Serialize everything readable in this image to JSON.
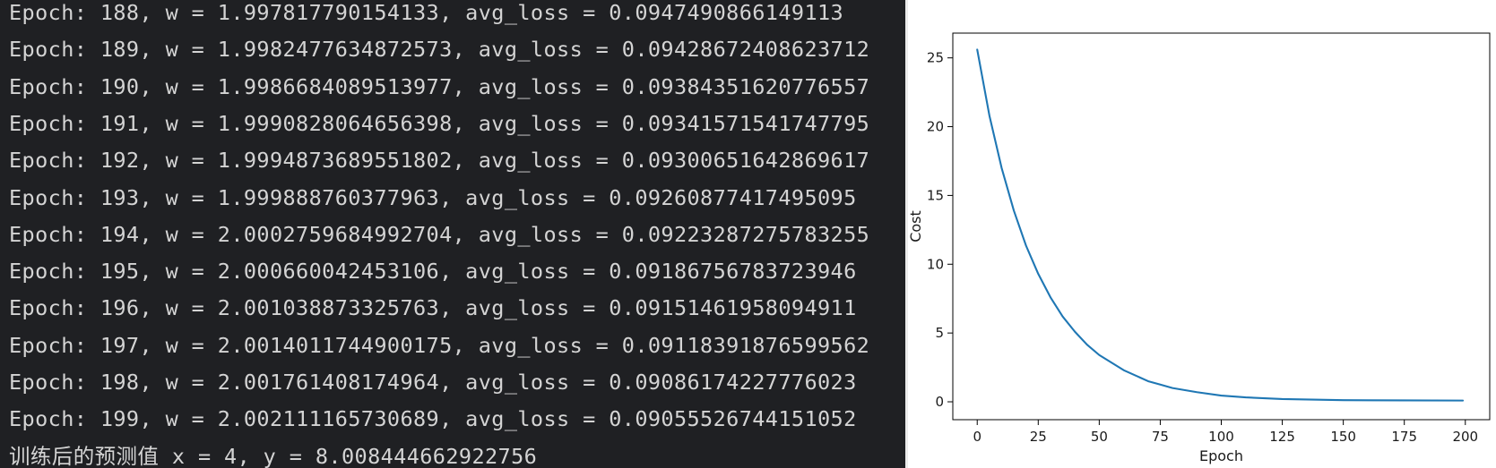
{
  "console": {
    "lines": [
      "Epoch: 188, w = 1.997817790154133, avg_loss = 0.0947490866149113",
      "Epoch: 189, w = 1.9982477634872573, avg_loss = 0.09428672408623712",
      "Epoch: 190, w = 1.9986684089513977, avg_loss = 0.09384351620776557",
      "Epoch: 191, w = 1.9990828064656398, avg_loss = 0.09341571541747795",
      "Epoch: 192, w = 1.9994873689551802, avg_loss = 0.09300651642869617",
      "Epoch: 193, w = 1.999888760377963, avg_loss = 0.09260877417495095",
      "Epoch: 194, w = 2.0002759684992704, avg_loss = 0.09223287275783255",
      "Epoch: 195, w = 2.000660042453106, avg_loss = 0.09186756783723946",
      "Epoch: 196, w = 2.001038873325763, avg_loss = 0.09151461958094911",
      "Epoch: 197, w = 2.0014011744900175, avg_loss = 0.09118391876599562",
      "Epoch: 198, w = 2.001761408174964, avg_loss = 0.09086174227776023",
      "Epoch: 199, w = 2.002111165730689, avg_loss = 0.09055526744151052",
      "训练后的预测值 x = 4, y = 8.008444662922756"
    ]
  },
  "chart_data": {
    "type": "line",
    "title": "",
    "xlabel": "Epoch",
    "ylabel": "Cost",
    "xlim": [
      -10,
      210
    ],
    "ylim": [
      -1.3,
      26.8
    ],
    "xticks": [
      0,
      25,
      50,
      75,
      100,
      125,
      150,
      175,
      200
    ],
    "xtick_labels": [
      "0",
      "25",
      "50",
      "75",
      "100",
      "125",
      "150",
      "175",
      "200"
    ],
    "yticks": [
      0,
      5,
      10,
      15,
      20,
      25
    ],
    "ytick_labels": [
      "0",
      "5",
      "10",
      "15",
      "20",
      "25"
    ],
    "grid": false,
    "legend": "none",
    "line_color": "#1f77b4",
    "series": [
      {
        "x": [
          0,
          5,
          10,
          15,
          20,
          25,
          30,
          35,
          40,
          45,
          50,
          60,
          70,
          75,
          80,
          90,
          100,
          110,
          125,
          150,
          175,
          199
        ],
        "y": [
          25.6,
          20.8,
          17.0,
          13.9,
          11.35,
          9.3,
          7.6,
          6.2,
          5.1,
          4.15,
          3.4,
          2.3,
          1.5,
          1.25,
          1.0,
          0.7,
          0.45,
          0.32,
          0.2,
          0.12,
          0.1,
          0.09
        ]
      }
    ]
  }
}
